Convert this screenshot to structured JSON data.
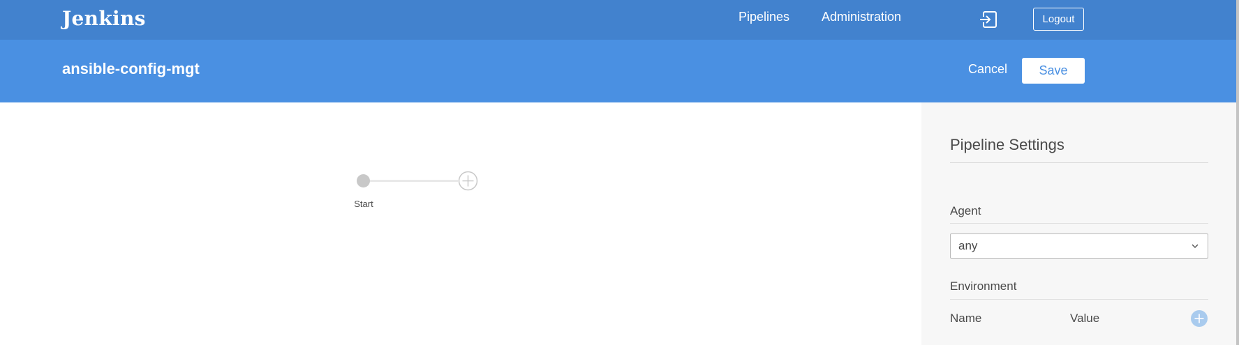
{
  "header": {
    "logo": "Jenkins",
    "nav": {
      "pipelines": "Pipelines",
      "administration": "Administration"
    },
    "logout_label": "Logout",
    "exit_icon": "exit-icon"
  },
  "subheader": {
    "title": "ansible-config-mgt",
    "cancel_label": "Cancel",
    "save_label": "Save"
  },
  "graph": {
    "start_label": "Start",
    "start_icon": "start-node-icon",
    "add_icon": "add-stage-icon"
  },
  "settings": {
    "title": "Pipeline Settings",
    "agent_label": "Agent",
    "agent_value": "any",
    "environment_label": "Environment",
    "env_columns": {
      "name": "Name",
      "value": "Value"
    },
    "add_icon": "plus-circle-icon"
  },
  "colors": {
    "topbar": "#4282ce",
    "subbar": "#4a90e2",
    "sidebar": "#f7f7f7",
    "accent": "#4a90e2"
  }
}
